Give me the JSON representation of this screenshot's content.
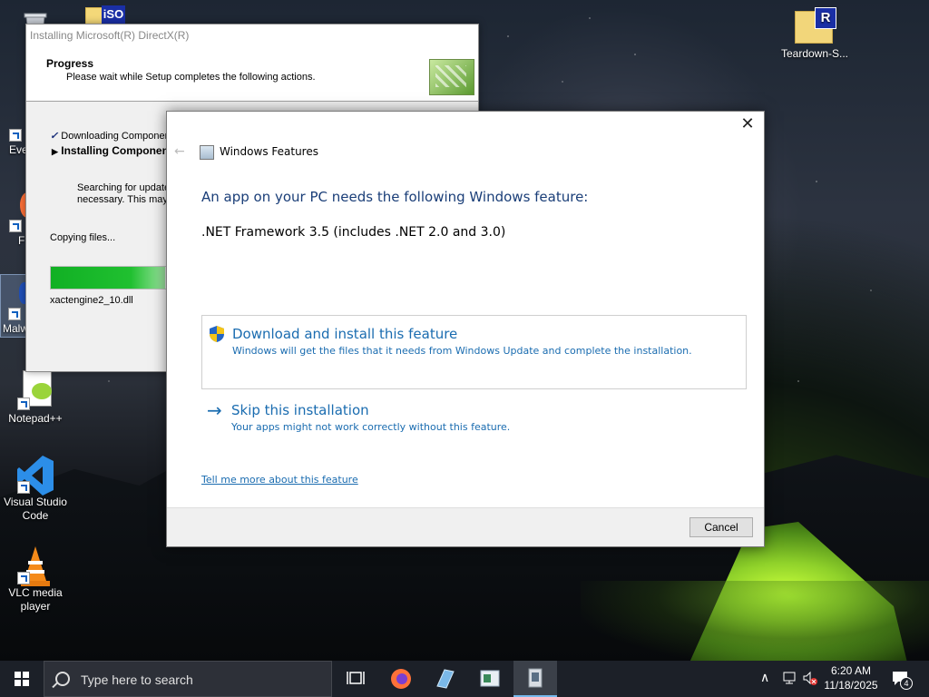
{
  "desktop": {
    "icons": [
      {
        "label": "Rec"
      },
      {
        "label": "Eve"
      },
      {
        "label": "F"
      },
      {
        "label": "Malw"
      },
      {
        "label": "Notepad++"
      },
      {
        "label": "Visual Studio Code"
      },
      {
        "label": "VLC media player"
      },
      {
        "label": "Teardown-S..."
      }
    ],
    "iso_badge": "iSO",
    "r_badge": "R"
  },
  "directx": {
    "title": "Installing Microsoft(R) DirectX(R)",
    "heading": "Progress",
    "subheading": "Please wait while Setup completes the following actions.",
    "step1": "Downloading Componen",
    "step2": "Installing Componen",
    "searching_line1": "Searching for update",
    "searching_line2": "necessary.  This may",
    "copying": "Copying files...",
    "filename": "xactengine2_10.dll",
    "progress_fraction": 0.42
  },
  "dialog": {
    "title": "Windows Features",
    "close_glyph": "✕",
    "back_glyph": "←",
    "message": "An app on your PC needs the following Windows feature:",
    "feature": ".NET Framework 3.5 (includes .NET 2.0 and 3.0)",
    "option_install": {
      "title": "Download and install this feature",
      "description": "Windows will get the files that it needs from Windows Update and complete the installation."
    },
    "option_skip": {
      "arrow": "→",
      "title": "Skip this installation",
      "description": "Your apps might not work correctly without this feature."
    },
    "link": "Tell me more about this feature",
    "cancel": "Cancel"
  },
  "taskbar": {
    "search_placeholder": "Type here to search",
    "time": "6:20 AM",
    "date": "11/18/2025",
    "notification_count": "4",
    "items": [
      "task-view",
      "firefox",
      "notepad",
      "app",
      "setup"
    ]
  }
}
